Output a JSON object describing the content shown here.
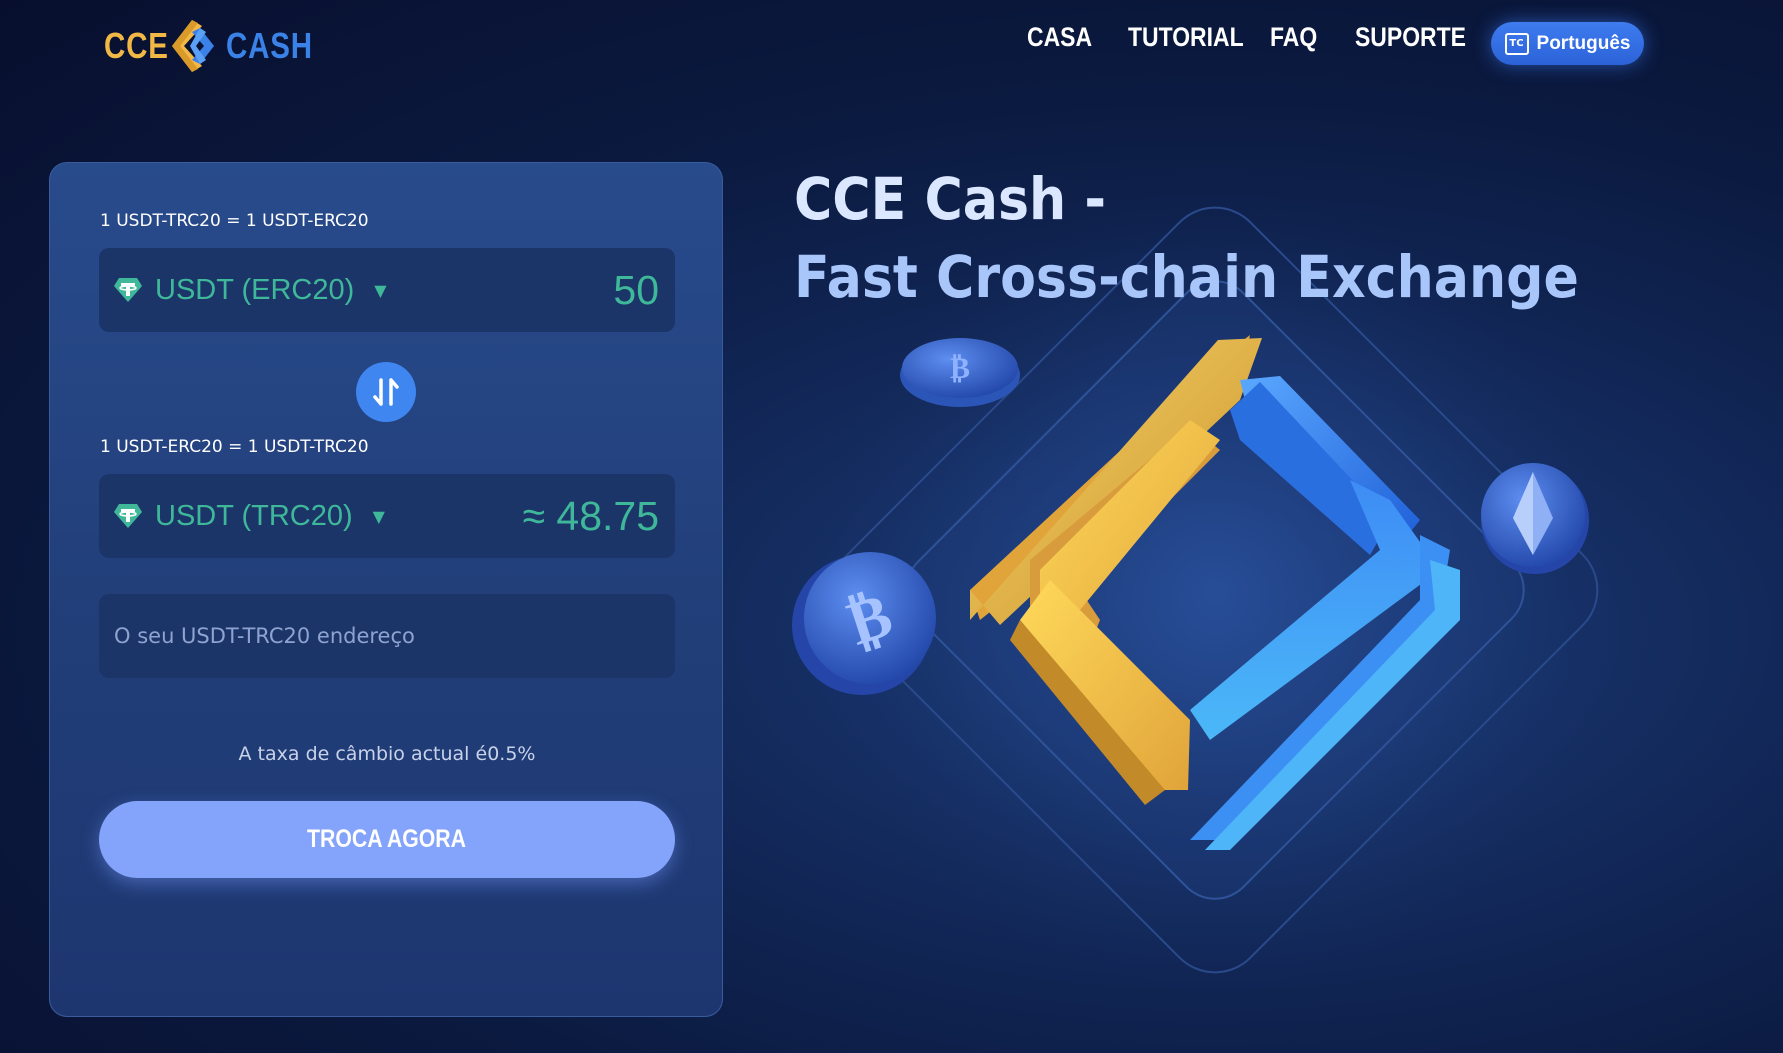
{
  "brand": {
    "left": "CCE",
    "right": "CASH"
  },
  "nav": {
    "home": "CASA",
    "tutorial": "TUTORIAL",
    "faq": "FAQ",
    "support": "SUPORTE"
  },
  "language": {
    "icon": "tc-icon",
    "label": "Português"
  },
  "exchange": {
    "from_rate": "1 USDT-TRC20 = 1 USDT-ERC20",
    "from_coin": "USDT (ERC20)",
    "from_amount": "50",
    "to_rate": "1 USDT-ERC20 = 1 USDT-TRC20",
    "to_coin": "USDT (TRC20)",
    "to_amount": "≈ 48.75",
    "address_placeholder": "O seu USDT-TRC20 endereço",
    "fee_text": "A taxa de câmbio actual é0.5%",
    "submit_label": "TROCA AGORA"
  },
  "hero": {
    "line1": "CCE Cash -",
    "line2": "Fast Cross-chain Exchange"
  },
  "colors": {
    "accent_gold": "#f2b846",
    "accent_blue": "#3a82e8",
    "green": "#3fb89a",
    "button": "#84a4fb"
  }
}
